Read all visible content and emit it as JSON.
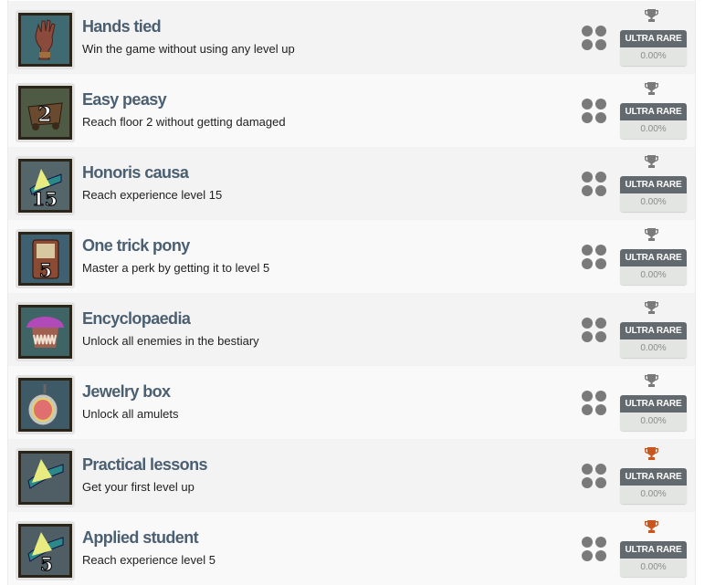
{
  "colors": {
    "title": "#4b5f72",
    "trophy_grey": "#7a7a7a",
    "trophy_bronze": "#c8561e",
    "badge_dark": "#626a70"
  },
  "achievements": [
    {
      "title": "Hands tied",
      "description": "Win the game without using any level up",
      "icon": "glove-icon",
      "trophy": "grey",
      "rarity": "ULTRA RARE",
      "percent": "0.00%"
    },
    {
      "title": "Easy peasy",
      "description": "Reach floor 2 without getting damaged",
      "icon": "minecart-2-icon",
      "trophy": "grey",
      "rarity": "ULTRA RARE",
      "percent": "0.00%"
    },
    {
      "title": "Honoris causa",
      "description": "Reach experience level 15",
      "icon": "graduation-15-icon",
      "trophy": "grey",
      "rarity": "ULTRA RARE",
      "percent": "0.00%"
    },
    {
      "title": "One trick pony",
      "description": "Master a perk by getting it to level 5",
      "icon": "perk-card-5-icon",
      "trophy": "grey",
      "rarity": "ULTRA RARE",
      "percent": "0.00%"
    },
    {
      "title": "Encyclopaedia",
      "description": "Unlock all enemies in the bestiary",
      "icon": "mushroom-monster-icon",
      "trophy": "grey",
      "rarity": "ULTRA RARE",
      "percent": "0.00%"
    },
    {
      "title": "Jewelry box",
      "description": "Unlock all amulets",
      "icon": "amulet-icon",
      "trophy": "grey",
      "rarity": "ULTRA RARE",
      "percent": "0.00%"
    },
    {
      "title": "Practical lessons",
      "description": "Get your first level up",
      "icon": "graduation-cap-icon",
      "trophy": "bronze",
      "rarity": "ULTRA RARE",
      "percent": "0.00%"
    },
    {
      "title": "Applied student",
      "description": "Reach experience level 5",
      "icon": "graduation-5-icon",
      "trophy": "bronze",
      "rarity": "ULTRA RARE",
      "percent": "0.00%"
    }
  ]
}
